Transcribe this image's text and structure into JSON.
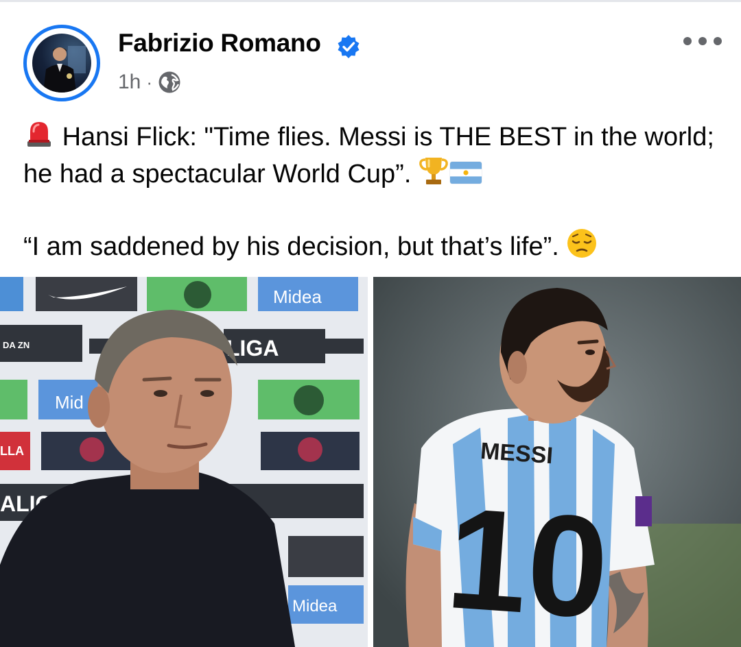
{
  "post": {
    "author": "Fabrizio Romano",
    "time": "1h",
    "separator": "·",
    "icons": {
      "verified": "verified-badge-icon",
      "privacy": "globe-icon",
      "more": "more-options-icon"
    },
    "paragraphs": [
      {
        "lead_emoji": "police-light-emoji",
        "text": "Hansi Flick: \"Time flies. Messi is THE BEST in the world; he had a spectacular World Cup”.",
        "trail_emojis": [
          "trophy-emoji",
          "argentina-flag-emoji"
        ]
      },
      {
        "text": "“I am saddened by his decision, but that’s life”.",
        "trail_emojis": [
          "pensive-face-emoji"
        ]
      }
    ]
  },
  "images": {
    "left": {
      "subject": "hansi-flick-photo",
      "backdrop_texts": [
        "Midea",
        "LIGA",
        "DA ZN",
        "LLA",
        "ALIGA",
        "Mid",
        "Midea"
      ]
    },
    "right": {
      "subject": "messi-photo",
      "jersey_name": "MESSI",
      "jersey_number": "10"
    }
  },
  "colors": {
    "accent": "#1877f2",
    "secondary_text": "#65676b",
    "primary_text": "#050505",
    "argentina_sky": "#74acdf"
  }
}
